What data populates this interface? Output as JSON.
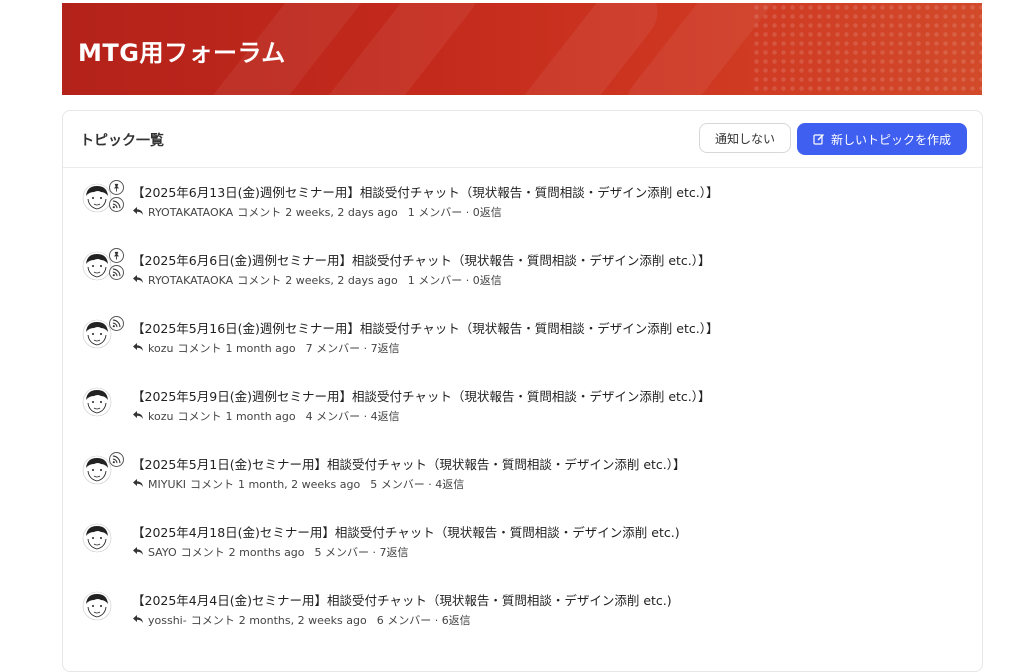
{
  "banner": {
    "title": "MTG用フォーラム"
  },
  "panel": {
    "title": "トピック一覧",
    "mute_label": "通知しない",
    "new_topic_label": "新しいトピックを作成"
  },
  "colors": {
    "accent": "#3f5ff0",
    "banner": "#c42a1c"
  },
  "topics": [
    {
      "title": "【2025年6月13日(金)週例セミナー用】相談受付チャット（現状報告・質問相談・デザイン添削 etc.）】",
      "author": "RYOTAKATAOKA",
      "comment_label": "コメント",
      "ago": "2 weeks, 2 days ago",
      "stats": "1 メンバー · 0返信",
      "pinned": true,
      "rss": true
    },
    {
      "title": "【2025年6月6日(金)週例セミナー用】相談受付チャット（現状報告・質問相談・デザイン添削 etc.）】",
      "author": "RYOTAKATAOKA",
      "comment_label": "コメント",
      "ago": "2 weeks, 2 days ago",
      "stats": "1 メンバー · 0返信",
      "pinned": true,
      "rss": true
    },
    {
      "title": "【2025年5月16日(金)週例セミナー用】相談受付チャット（現状報告・質問相談・デザイン添削 etc.）】",
      "author": "kozu",
      "comment_label": "コメント",
      "ago": "1 month ago",
      "stats": "7 メンバー · 7返信",
      "pinned": false,
      "rss": true
    },
    {
      "title": "【2025年5月9日(金)週例セミナー用】相談受付チャット（現状報告・質問相談・デザイン添削 etc.）】",
      "author": "kozu",
      "comment_label": "コメント",
      "ago": "1 month ago",
      "stats": "4 メンバー · 4返信",
      "pinned": false,
      "rss": false
    },
    {
      "title": "【2025年5月1日(金)セミナー用】相談受付チャット（現状報告・質問相談・デザイン添削 etc.）】",
      "author": "MIYUKI",
      "comment_label": "コメント",
      "ago": "1 month, 2 weeks ago",
      "stats": "5 メンバー · 4返信",
      "pinned": false,
      "rss": true
    },
    {
      "title": "【2025年4月18日(金)セミナー用】相談受付チャット（現状報告・質問相談・デザイン添削 etc.)",
      "author": "SAYO",
      "comment_label": "コメント",
      "ago": "2 months ago",
      "stats": "5 メンバー · 7返信",
      "pinned": false,
      "rss": false
    },
    {
      "title": "【2025年4月4日(金)セミナー用】相談受付チャット（現状報告・質問相談・デザイン添削 etc.)",
      "author": "yosshi-",
      "comment_label": "コメント",
      "ago": "2 months, 2 weeks ago",
      "stats": "6 メンバー · 6返信",
      "pinned": false,
      "rss": false
    }
  ]
}
